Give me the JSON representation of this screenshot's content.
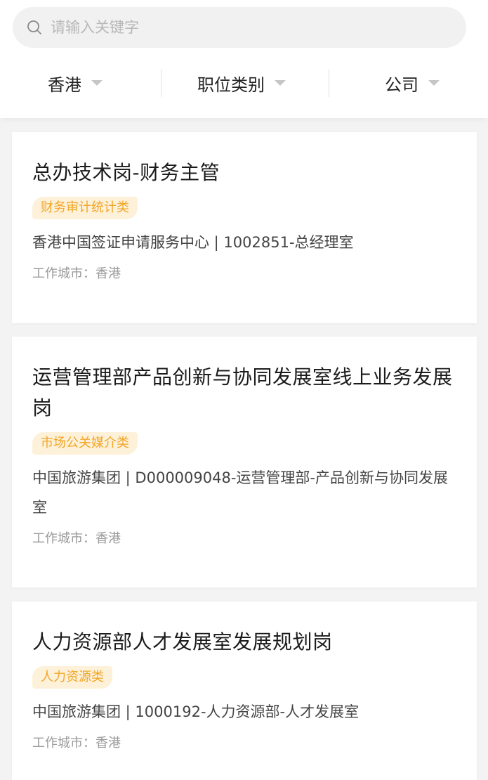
{
  "search": {
    "placeholder": "请输入关键字"
  },
  "filters": [
    {
      "label": "香港"
    },
    {
      "label": "职位类别"
    },
    {
      "label": "公司"
    }
  ],
  "jobs": [
    {
      "title": "总办技术岗-财务主管",
      "tag": "财务审计统计类",
      "company": "香港中国签证申请服务中心 | 1002851-总经理室",
      "city_label": "工作城市：",
      "city": "香港"
    },
    {
      "title": "运营管理部产品创新与协同发展室线上业务发展岗",
      "tag": "市场公关媒介类",
      "company": "中国旅游集团 | D000009048-运营管理部-产品创新与协同发展室",
      "city_label": "工作城市：",
      "city": "香港"
    },
    {
      "title": "人力资源部人才发展室发展规划岗",
      "tag": "人力资源类",
      "company": "中国旅游集团 | 1000192-人力资源部-人才发展室",
      "city_label": "工作城市：",
      "city": "香港"
    }
  ],
  "colors": {
    "tag_bg": "#fdf1d9",
    "tag_text": "#f2a628",
    "page_bg": "#f3f3f3"
  }
}
